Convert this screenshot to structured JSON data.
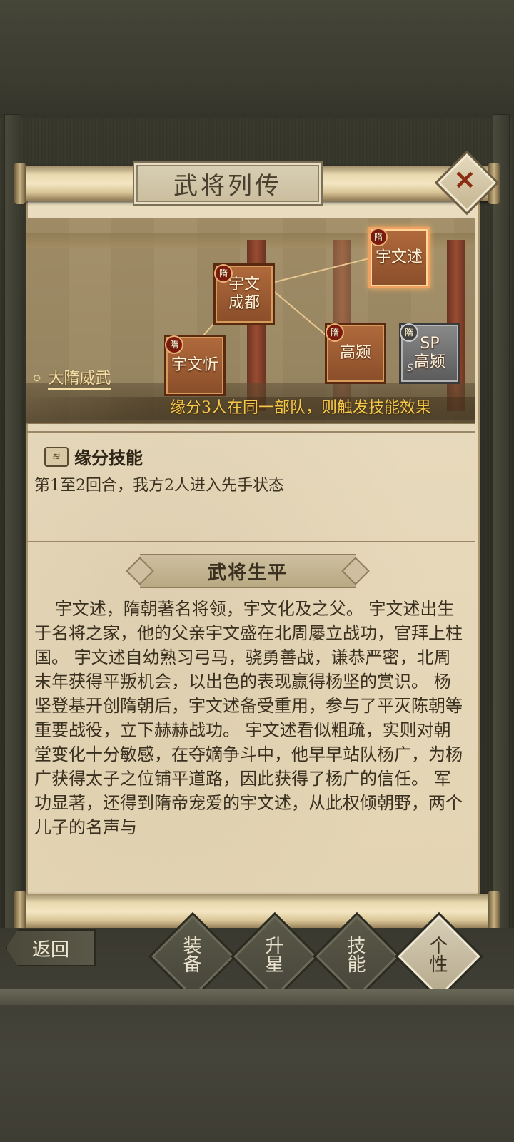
{
  "window": {
    "title": "武将列传",
    "close_icon": "close-icon"
  },
  "bond": {
    "name": "大隋威武",
    "condition": "缘分3人在同一部队，则触发技能效果",
    "members": [
      {
        "name": "宇文述",
        "faction_badge": "隋",
        "highlighted": true
      },
      {
        "name": "宇文\n成都",
        "faction_badge": "隋",
        "highlighted": false
      },
      {
        "name": "高颎",
        "faction_badge": "隋",
        "highlighted": false
      },
      {
        "name": "宇文忻",
        "faction_badge": "隋",
        "highlighted": false
      },
      {
        "name": "SP\n高颎",
        "faction_badge": "隋",
        "highlighted": false,
        "greyed": true
      }
    ]
  },
  "skill": {
    "title": "缘分技能",
    "description": "第1至2回合，我方2人进入先手状态"
  },
  "biography": {
    "title": "武将生平",
    "text": "宇文述，隋朝著名将领，宇文化及之父。  宇文述出生于名将之家，他的父亲宇文盛在北周屡立战功，官拜上柱国。  宇文述自幼熟习弓马，骁勇善战，谦恭严密，北周末年获得平叛机会，以出色的表现赢得杨坚的赏识。  杨坚登基开创隋朝后，宇文述备受重用，参与了平灭陈朝等重要战役，立下赫赫战功。  宇文述看似粗疏，实则对朝堂变化十分敏感，在夺嫡争斗中，他早早站队杨广，为杨广获得太子之位铺平道路，因此获得了杨广的信任。 军功显著，还得到隋帝宠爱的宇文述，从此权倾朝野，两个儿子的名声与"
  },
  "nav": {
    "back": "返回",
    "tabs": [
      {
        "label": "装备",
        "active": false
      },
      {
        "label": "升星",
        "active": false
      },
      {
        "label": "技能",
        "active": false
      },
      {
        "label": "个性",
        "active": true
      }
    ]
  },
  "colors": {
    "paper": "#e6d8b9",
    "accent_gold": "#f5c94a",
    "card_orange": "#a0603a",
    "text_dark": "#3a3020"
  }
}
